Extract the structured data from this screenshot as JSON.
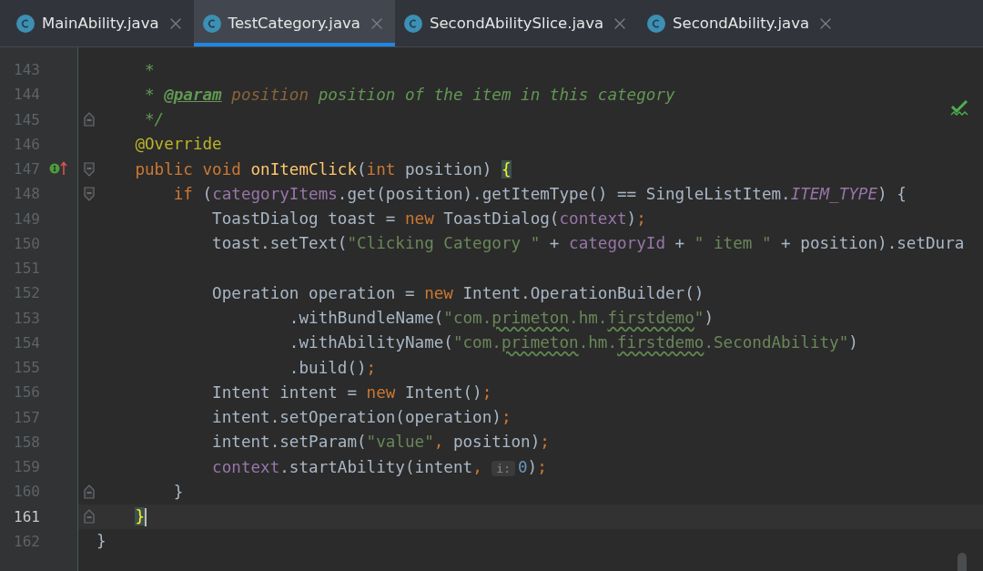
{
  "tabs": [
    {
      "label": "MainAbility.java",
      "selected": false
    },
    {
      "label": "TestCategory.java",
      "selected": true
    },
    {
      "label": "SecondAbilitySlice.java",
      "selected": false
    },
    {
      "label": "SecondAbility.java",
      "selected": false
    }
  ],
  "editor": {
    "lines": [
      {
        "number": "143",
        "current": false,
        "tokens": [
          {
            "kind": "comment",
            "text": "     *"
          }
        ]
      },
      {
        "number": "144",
        "current": false,
        "tokens": [
          {
            "kind": "comment",
            "text": "     * "
          },
          {
            "kind": "doctag",
            "text": "@param"
          },
          {
            "kind": "docparam",
            "text": " position"
          },
          {
            "kind": "comment",
            "text": " position of the item in this category"
          }
        ]
      },
      {
        "number": "145",
        "current": false,
        "gutter_icons": [
          {
            "kind": "fold_end"
          }
        ],
        "tokens": [
          {
            "kind": "comment",
            "text": "     */"
          }
        ]
      },
      {
        "number": "146",
        "current": false,
        "tokens": [
          {
            "kind": "annotation",
            "text": "    @Override"
          }
        ]
      },
      {
        "number": "147",
        "current": false,
        "gutter_icons": [
          {
            "kind": "implements"
          },
          {
            "kind": "fold_start"
          }
        ],
        "tokens": [
          {
            "kind": "keyword",
            "text": "    public void "
          },
          {
            "kind": "method",
            "text": "onItemClick"
          },
          {
            "kind": "plain",
            "text": "("
          },
          {
            "kind": "keyword",
            "text": "int"
          },
          {
            "kind": "plain",
            "text": " position) "
          },
          {
            "kind": "brace",
            "text": "{"
          }
        ]
      },
      {
        "number": "148",
        "current": false,
        "gutter_icons": [
          {
            "kind": "fold_start"
          }
        ],
        "tokens": [
          {
            "kind": "keyword",
            "text": "        if "
          },
          {
            "kind": "plain",
            "text": "("
          },
          {
            "kind": "field",
            "text": "categoryItems"
          },
          {
            "kind": "plain",
            "text": ".get(position).getItemType() == SingleListItem."
          },
          {
            "kind": "static",
            "text": "ITEM_TYPE"
          },
          {
            "kind": "plain",
            "text": ") {"
          }
        ]
      },
      {
        "number": "149",
        "current": false,
        "tokens": [
          {
            "kind": "plain",
            "text": "            ToastDialog toast = "
          },
          {
            "kind": "keyword",
            "text": "new"
          },
          {
            "kind": "plain",
            "text": " ToastDialog("
          },
          {
            "kind": "field",
            "text": "context"
          },
          {
            "kind": "plain",
            "text": ")"
          },
          {
            "kind": "keyword",
            "text": ";"
          }
        ]
      },
      {
        "number": "150",
        "current": false,
        "tokens": [
          {
            "kind": "plain",
            "text": "            toast.setText("
          },
          {
            "kind": "string",
            "text": "\"Clicking Category \""
          },
          {
            "kind": "plain",
            "text": " + "
          },
          {
            "kind": "field",
            "text": "categoryId"
          },
          {
            "kind": "plain",
            "text": " + "
          },
          {
            "kind": "string",
            "text": "\" item \""
          },
          {
            "kind": "plain",
            "text": " + position).setDura"
          }
        ]
      },
      {
        "number": "151"
      },
      {
        "number": "152",
        "current": false,
        "tokens": [
          {
            "kind": "plain",
            "text": "            Operation operation = "
          },
          {
            "kind": "keyword",
            "text": "new"
          },
          {
            "kind": "plain",
            "text": " Intent.OperationBuilder()"
          }
        ]
      },
      {
        "number": "153",
        "current": false,
        "tokens": [
          {
            "kind": "plain",
            "text": "                    .withBundleName("
          },
          {
            "kind": "string",
            "text": "\"com."
          },
          {
            "kind": "typo",
            "text": "primeton"
          },
          {
            "kind": "string",
            "text": ".hm."
          },
          {
            "kind": "typo",
            "text": "firstdemo"
          },
          {
            "kind": "string",
            "text": "\""
          },
          {
            "kind": "plain",
            "text": ")"
          }
        ]
      },
      {
        "number": "154",
        "current": false,
        "tokens": [
          {
            "kind": "plain",
            "text": "                    .withAbilityName("
          },
          {
            "kind": "string",
            "text": "\"com."
          },
          {
            "kind": "typo",
            "text": "primeton"
          },
          {
            "kind": "string",
            "text": ".hm."
          },
          {
            "kind": "typo",
            "text": "firstdemo"
          },
          {
            "kind": "string",
            "text": ".SecondAbility\""
          },
          {
            "kind": "plain",
            "text": ")"
          }
        ]
      },
      {
        "number": "155",
        "current": false,
        "tokens": [
          {
            "kind": "plain",
            "text": "                    .build()"
          },
          {
            "kind": "keyword",
            "text": ";"
          }
        ]
      },
      {
        "number": "156",
        "current": false,
        "tokens": [
          {
            "kind": "plain",
            "text": "            Intent intent = "
          },
          {
            "kind": "keyword",
            "text": "new"
          },
          {
            "kind": "plain",
            "text": " Intent()"
          },
          {
            "kind": "keyword",
            "text": ";"
          }
        ]
      },
      {
        "number": "157",
        "current": false,
        "tokens": [
          {
            "kind": "plain",
            "text": "            intent.setOperation(operation)"
          },
          {
            "kind": "keyword",
            "text": ";"
          }
        ]
      },
      {
        "number": "158",
        "current": false,
        "tokens": [
          {
            "kind": "plain",
            "text": "            intent.setParam("
          },
          {
            "kind": "string",
            "text": "\"value\""
          },
          {
            "kind": "keyword",
            "text": ","
          },
          {
            "kind": "plain",
            "text": " position)"
          },
          {
            "kind": "keyword",
            "text": ";"
          }
        ]
      },
      {
        "number": "159",
        "current": false,
        "tokens": [
          {
            "kind": "field",
            "text": "            context"
          },
          {
            "kind": "plain",
            "text": ".startAbility(intent"
          },
          {
            "kind": "keyword",
            "text": ", "
          },
          {
            "kind": "hint",
            "text": "i:"
          },
          {
            "kind": "number",
            "text": "0"
          },
          {
            "kind": "plain",
            "text": ")"
          },
          {
            "kind": "keyword",
            "text": ";"
          }
        ]
      },
      {
        "number": "160",
        "current": false,
        "gutter_icons": [
          {
            "kind": "fold_end"
          }
        ],
        "tokens": [
          {
            "kind": "plain",
            "text": "        }"
          }
        ]
      },
      {
        "number": "161",
        "current": true,
        "gutter_icons": [
          {
            "kind": "fold_end"
          }
        ],
        "tokens": [
          {
            "kind": "brace",
            "text": "    }"
          }
        ]
      },
      {
        "number": "162",
        "current": false,
        "tokens": [
          {
            "kind": "plain",
            "text": "}"
          }
        ]
      }
    ]
  }
}
